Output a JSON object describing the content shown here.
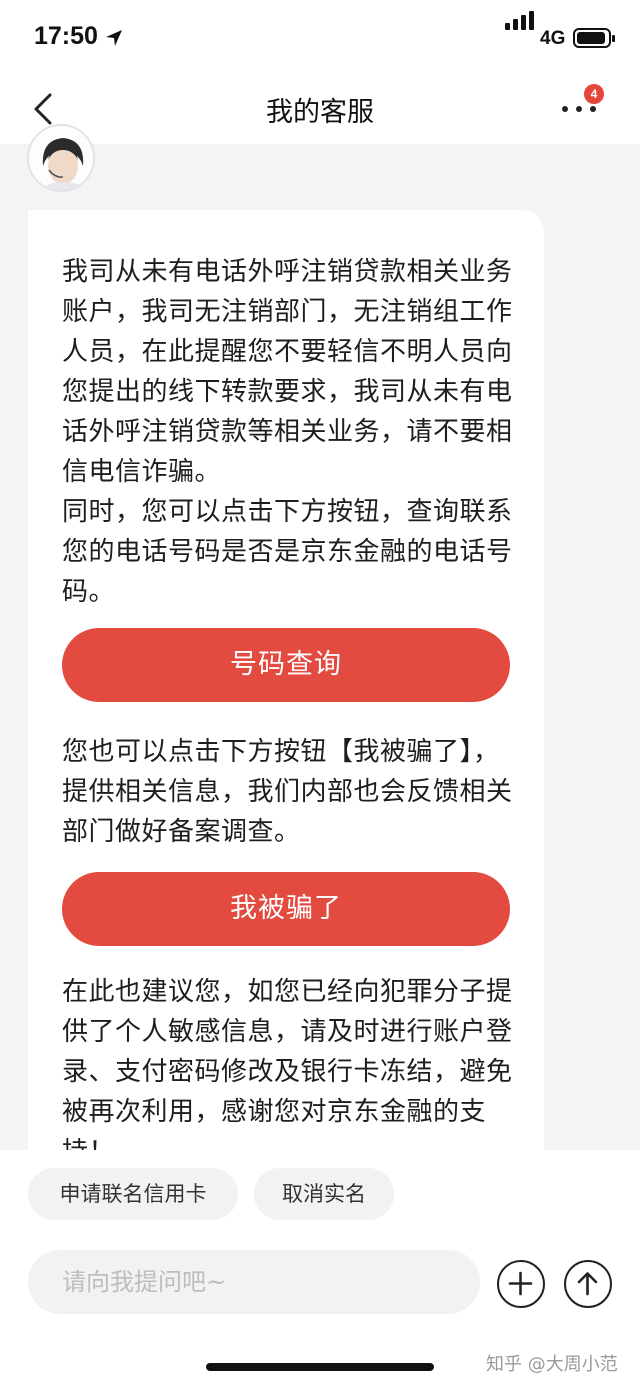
{
  "status_bar": {
    "time": "17:50",
    "network": "4G"
  },
  "nav": {
    "title": "我的客服",
    "badge_count": "4"
  },
  "message": {
    "para1": "我司从未有电话外呼注销贷款相关业务账户，我司无注销部门，无注销组工作人员，在此提醒您不要轻信不明人员向您提出的线下转款要求，我司从未有电话外呼注销贷款等相关业务，请不要相信电信诈骗。",
    "para2": "同时，您可以点击下方按钮，查询联系您的电话号码是否是京东金融的电话号码。",
    "button1": "号码查询",
    "para3": "您也可以点击下方按钮【我被骗了】，提供相关信息，我们内部也会反馈相关部门做好备案调查。",
    "button2": "我被骗了",
    "para4": "在此也建议您，如您已经向犯罪分子提供了个人敏感信息，请及时进行账户登录、支付密码修改及银行卡冻结，避免被再次利用，感谢您对京东金融的支持！"
  },
  "quick_replies": [
    "申请联名信用卡",
    "取消实名"
  ],
  "input": {
    "placeholder": "请向我提问吧~"
  },
  "watermark": "知乎 @大周小范",
  "colors": {
    "accent": "#e34a40",
    "badge": "#e5453a",
    "background": "#f4f4f6"
  }
}
